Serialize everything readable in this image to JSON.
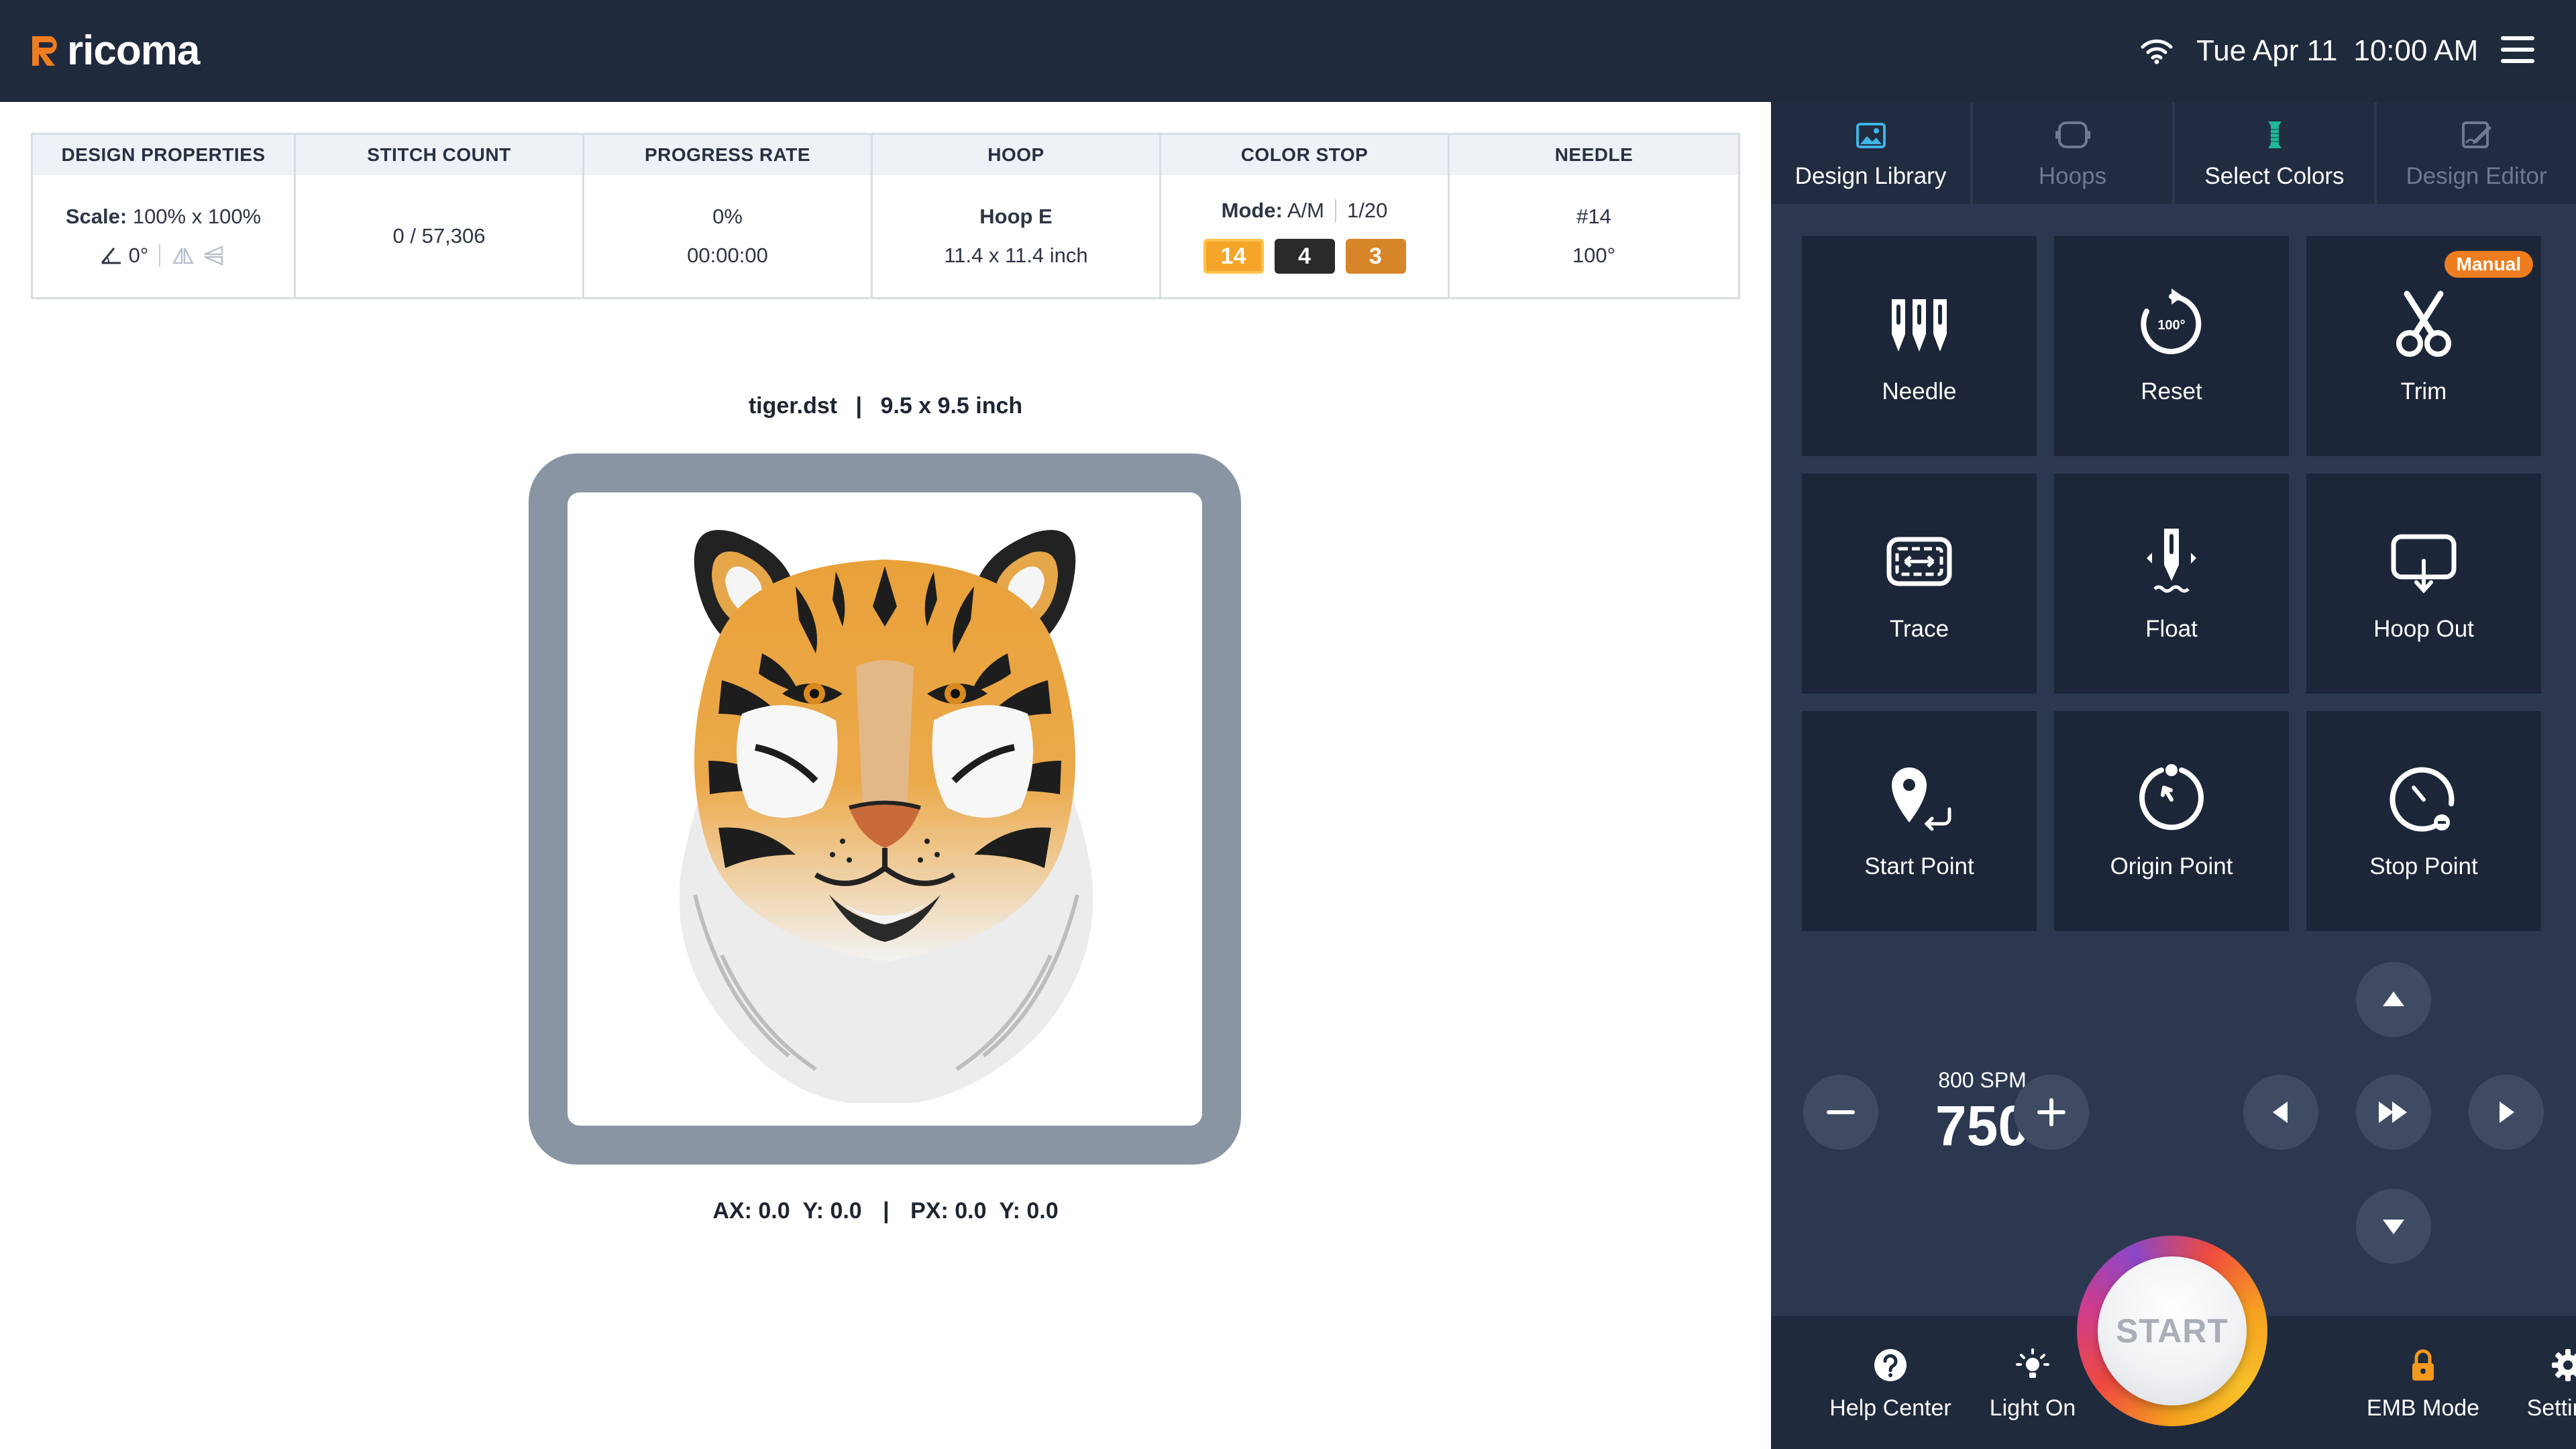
{
  "app": {
    "brand": "ricoma"
  },
  "status": {
    "date": "Tue Apr 11",
    "time": "10:00 AM"
  },
  "info": {
    "design_properties": {
      "label": "DESIGN PROPERTIES",
      "scale_label": "Scale:",
      "scale_value": "100% x 100%",
      "rotation": "0°"
    },
    "stitch_count": {
      "label": "STITCH COUNT",
      "value": "0 / 57,306"
    },
    "progress_rate": {
      "label": "PROGRESS RATE",
      "percent": "0%",
      "elapsed": "00:00:00"
    },
    "hoop": {
      "label": "HOOP",
      "name": "Hoop E",
      "size": "11.4 x 11.4 inch"
    },
    "color_stop": {
      "label": "COLOR STOP",
      "mode_label": "Mode:",
      "mode_value": "A/M",
      "position": "1/20",
      "chips": [
        {
          "value": "14",
          "color": "#f4a62a"
        },
        {
          "value": "4",
          "color": "#2a2a2a"
        },
        {
          "value": "3",
          "color": "#d8862a"
        }
      ]
    },
    "needle": {
      "label": "NEEDLE",
      "number": "#14",
      "angle": "100°"
    }
  },
  "design": {
    "file": "tiger.dst",
    "separator": "|",
    "size": "9.5 x 9.5 inch"
  },
  "coords": {
    "ax": "AX: 0.0",
    "ay": "Y: 0.0",
    "separator": "|",
    "px": "PX: 0.0",
    "py": "Y: 0.0"
  },
  "tabs": [
    {
      "label": "Design Library",
      "icon": "image-icon",
      "active": true
    },
    {
      "label": "Hoops",
      "icon": "hoop-icon",
      "active": false
    },
    {
      "label": "Select Colors",
      "icon": "thread-spool-icon",
      "active": true
    },
    {
      "label": "Design Editor",
      "icon": "edit-design-icon",
      "active": false
    }
  ],
  "tiles": [
    {
      "label": "Needle",
      "icon": "needles-icon"
    },
    {
      "label": "Reset",
      "icon": "reset-icon",
      "icon_text": "100°"
    },
    {
      "label": "Trim",
      "icon": "scissors-icon",
      "badge": "Manual"
    },
    {
      "label": "Trace",
      "icon": "trace-icon"
    },
    {
      "label": "Float",
      "icon": "float-icon"
    },
    {
      "label": "Hoop Out",
      "icon": "hoop-out-icon"
    },
    {
      "label": "Start Point",
      "icon": "start-point-icon"
    },
    {
      "label": "Origin Point",
      "icon": "origin-point-icon"
    },
    {
      "label": "Stop Point",
      "icon": "stop-point-icon"
    }
  ],
  "speed": {
    "max_label": "800 SPM",
    "value": "750"
  },
  "bottom": [
    {
      "label": "Help Center",
      "icon": "help-icon"
    },
    {
      "label": "Light On",
      "icon": "light-icon"
    },
    {
      "label": "EMB Mode",
      "icon": "lock-icon"
    },
    {
      "label": "Settings",
      "icon": "gear-icon"
    }
  ],
  "start": {
    "label": "START"
  },
  "colors": {
    "topbar": "#1f2a3d",
    "panel": "#2c3850",
    "tile": "#1c2638",
    "accent": "#ee7d20",
    "tab_active_icon": "#3fb4e8",
    "spool": "#1fb89a"
  }
}
